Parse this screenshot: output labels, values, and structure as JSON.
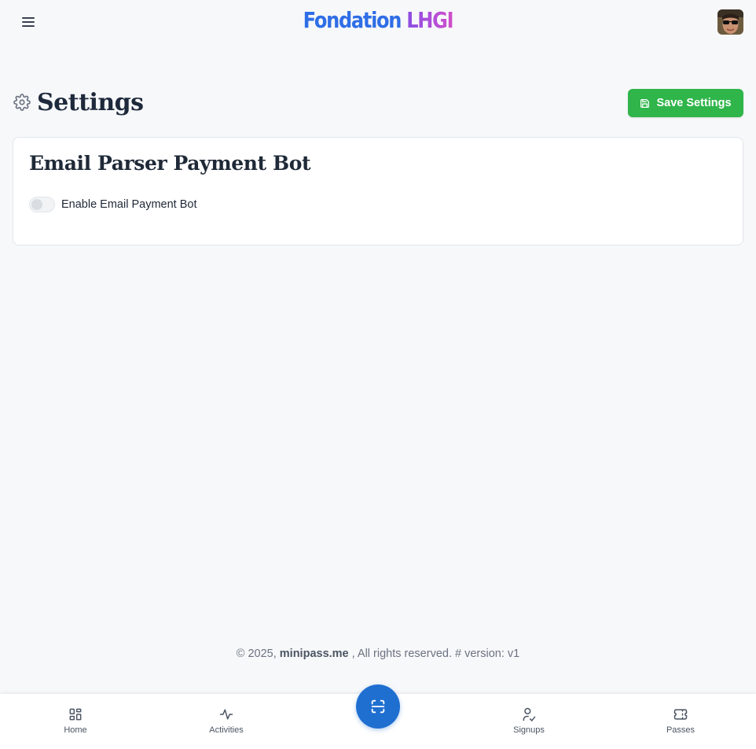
{
  "header": {
    "brand_part1": "Fondation",
    "brand_part2": "LHGI",
    "brand_color_1": "#2f6ee6",
    "brand_color_2": "#b44fd8",
    "menu_icon": "hamburger-icon",
    "avatar_icon": "user-avatar"
  },
  "page": {
    "title": "Settings",
    "title_icon": "gear-icon",
    "save_label": "Save Settings",
    "save_icon": "floppy-disk-icon",
    "save_color": "#2fb54a"
  },
  "card": {
    "title": "Email Parser Payment Bot",
    "toggle_label": "Enable Email Payment Bot",
    "toggle_on": false
  },
  "footer": {
    "prefix": "© 2025,",
    "site": "minipass.me",
    "suffix": ", All rights reserved. # version: v1"
  },
  "bottom_nav": {
    "items": [
      {
        "label": "Home",
        "icon": "grid-icon"
      },
      {
        "label": "Activities",
        "icon": "activity-icon"
      },
      {
        "label": "Signups",
        "icon": "user-check-icon"
      },
      {
        "label": "Passes",
        "icon": "ticket-icon"
      }
    ],
    "scan_icon": "scan-icon",
    "scan_color": "#1f6fd1"
  }
}
